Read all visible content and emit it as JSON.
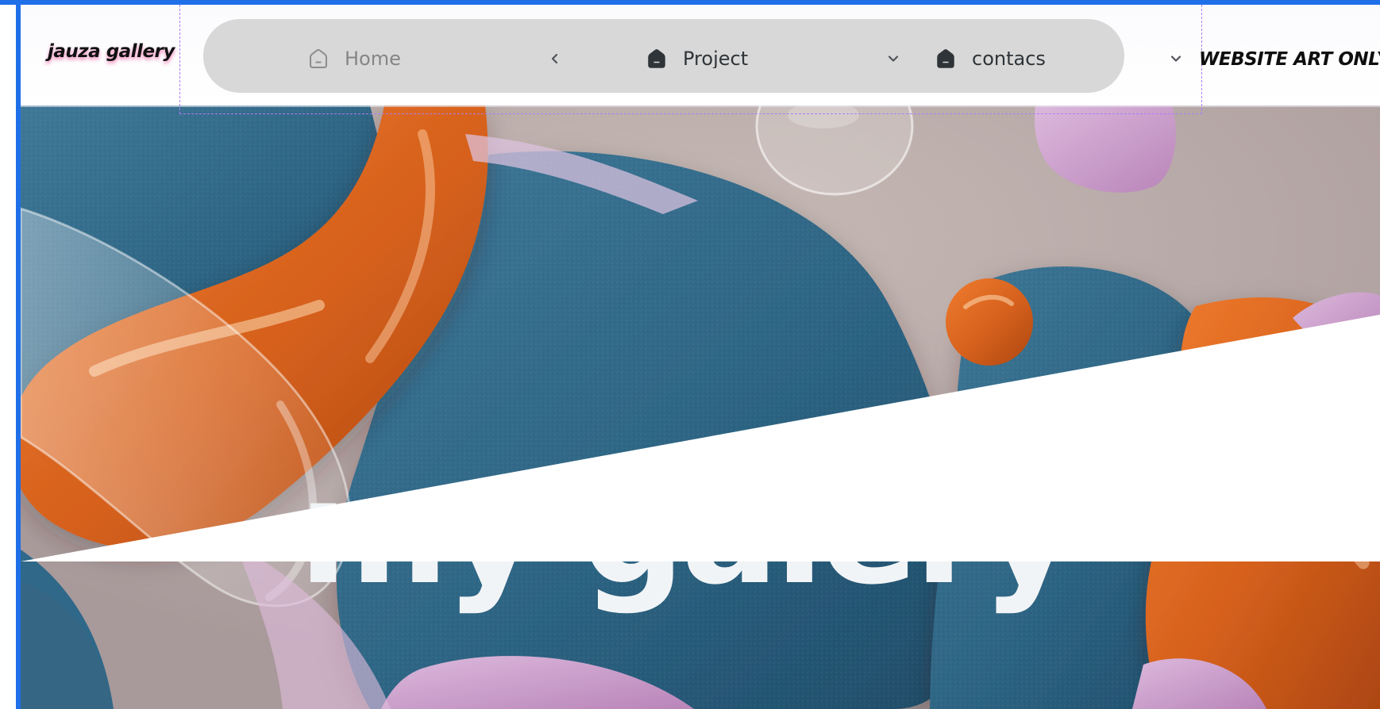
{
  "header": {
    "logo": "jauza gallery",
    "right_label": "WEBSITE ART ONLY"
  },
  "nav": {
    "items": [
      {
        "label": "Home",
        "icon": "home-icon",
        "chevron": "chevron-left-icon",
        "state": "muted"
      },
      {
        "label": "Project",
        "icon": "home-icon",
        "chevron": "chevron-down-icon",
        "state": "active"
      },
      {
        "label": "contacs",
        "icon": "home-icon",
        "chevron": "chevron-down-icon",
        "state": "active"
      }
    ]
  },
  "hero": {
    "title": "my galery"
  },
  "colors": {
    "accent_outline": "#1f6fe8",
    "nav_background": "#d8d8d8",
    "nav_text": "#2f3438",
    "hero_blue": "#356b89",
    "hero_orange": "#d9661f",
    "hero_purple": "#c8a0c9",
    "hero_background": "#b5a8a4"
  }
}
